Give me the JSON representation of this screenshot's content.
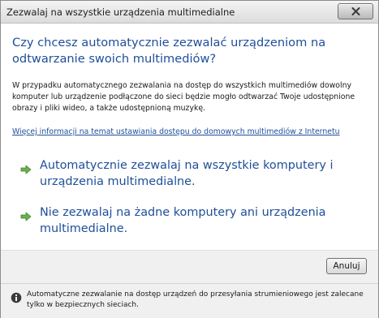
{
  "window": {
    "title": "Zezwalaj na wszystkie urządzenia multimedialne"
  },
  "main": {
    "heading": "Czy chcesz automatycznie zezwalać urządzeniom na odtwarzanie swoich multimediów?",
    "description": "W przypadku automatycznego zezwalania na dostęp do wszystkich multimediów dowolny komputer lub urządzenie podłączone do sieci będzie mogło odtwarzać Twoje udostępnione obrazy i pliki wideo, a także udostępnioną muzykę.",
    "help_link": "Więcej informacji na temat ustawiania dostępu do domowych multimediów z Internetu",
    "options": [
      {
        "label": "Automatycznie zezwalaj na wszystkie komputery i urządzenia multimedialne."
      },
      {
        "label": "Nie zezwalaj na żadne komputery ani urządzenia multimedialne."
      }
    ]
  },
  "buttons": {
    "cancel": "Anuluj"
  },
  "footer": {
    "text": "Automatyczne zezwalanie na dostęp urządzeń do przesyłania strumieniowego jest zalecane tylko w bezpiecznych sieciach."
  },
  "icons": {
    "close": "close-icon",
    "option_arrow": "arrow-right-icon",
    "info": "info-icon"
  },
  "colors": {
    "link_blue": "#1f4e9a",
    "arrow_green": "#3a8f3a",
    "info_blue": "#2f6fbd"
  }
}
